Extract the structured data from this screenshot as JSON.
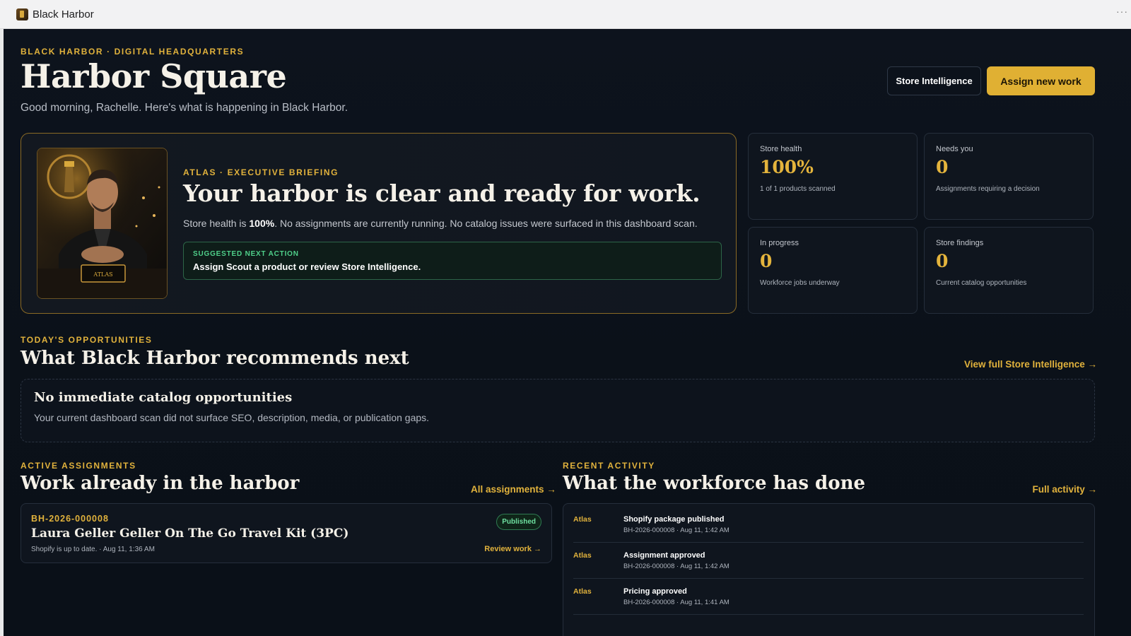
{
  "window": {
    "title": "Black Harbor",
    "more_label": "···"
  },
  "header": {
    "eyebrow": "BLACK HARBOR · DIGITAL HEADQUARTERS",
    "title": "Harbor Square",
    "subtitle": "Good morning, Rachelle. Here's what is happening in Black Harbor.",
    "secondary_button": "Store Intelligence",
    "primary_button": "Assign new work"
  },
  "briefing": {
    "eyebrow": "ATLAS · EXECUTIVE BRIEFING",
    "title": "Your harbor is clear and ready for work.",
    "text_prefix": "Store health is ",
    "text_value": "100%",
    "text_suffix": ". No assignments are currently running. No catalog issues were surfaced in this dashboard scan.",
    "portrait_plaque": "ATLAS",
    "next_action_label": "SUGGESTED NEXT ACTION",
    "next_action_text": "Assign Scout a product or review Store Intelligence."
  },
  "stats": [
    {
      "label": "Store health",
      "value": "100%",
      "desc": "1 of 1 products scanned"
    },
    {
      "label": "Needs you",
      "value": "0",
      "desc": "Assignments requiring a decision"
    },
    {
      "label": "In progress",
      "value": "0",
      "desc": "Workforce jobs underway"
    },
    {
      "label": "Store findings",
      "value": "0",
      "desc": "Current catalog opportunities"
    }
  ],
  "opportunities": {
    "eyebrow": "TODAY'S OPPORTUNITIES",
    "title": "What Black Harbor recommends next",
    "link": "View full Store Intelligence →",
    "empty_title": "No immediate catalog opportunities",
    "empty_text": "Your current dashboard scan did not surface SEO, description, media, or publication gaps."
  },
  "assignments": {
    "eyebrow": "ACTIVE ASSIGNMENTS",
    "title": "Work already in the harbor",
    "link": "All assignments →",
    "items": [
      {
        "id": "BH-2026-000008",
        "name": "Laura Geller Geller On The Go Travel Kit (3PC)",
        "meta": "Shopify is up to date. · Aug 11, 1:36 AM",
        "status": "Published",
        "action": "Review work →"
      }
    ]
  },
  "activity": {
    "eyebrow": "RECENT ACTIVITY",
    "title": "What the workforce has done",
    "link": "Full activity →",
    "items": [
      {
        "actor": "Atlas",
        "title": "Shopify package published",
        "meta": "BH-2026-000008 · Aug 11, 1:42 AM"
      },
      {
        "actor": "Atlas",
        "title": "Assignment approved",
        "meta": "BH-2026-000008 · Aug 11, 1:42 AM"
      },
      {
        "actor": "Atlas",
        "title": "Pricing approved",
        "meta": "BH-2026-000008 · Aug 11, 1:41 AM"
      }
    ]
  },
  "colors": {
    "accent": "#e0b033",
    "background": "#0b1119",
    "success": "#4fd08a",
    "card_border": "#252e3b"
  }
}
